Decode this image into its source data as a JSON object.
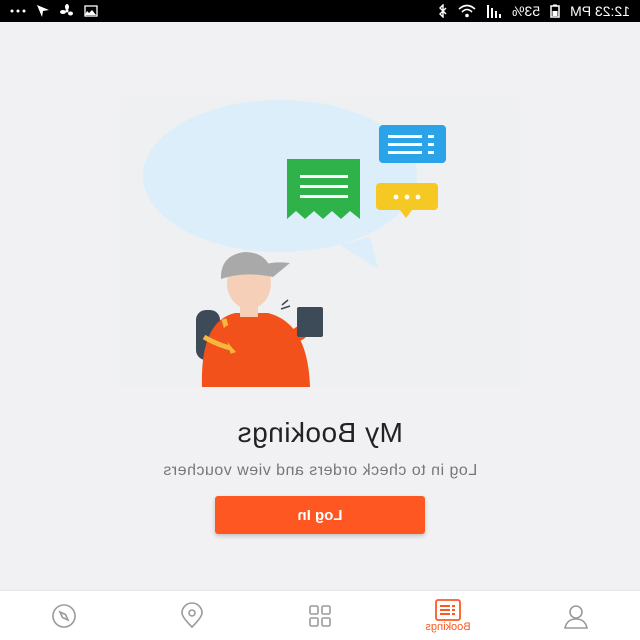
{
  "status_bar": {
    "time": "12:23 PM",
    "battery": "53%",
    "icons": [
      "bluetooth-icon",
      "wifi-icon",
      "signal-icon",
      "battery-icon",
      "more-icon",
      "location-arrow-icon",
      "fan-icon",
      "image-icon"
    ]
  },
  "main": {
    "title": "My Bookings",
    "subtitle": "Log in to check orders and view vouchers",
    "login_label": "Log In"
  },
  "bottom_nav": {
    "items": [
      {
        "icon": "compass-icon",
        "label": ""
      },
      {
        "icon": "location-pin-icon",
        "label": ""
      },
      {
        "icon": "grid-icon",
        "label": ""
      },
      {
        "icon": "bookings-icon",
        "label": "Bookings",
        "active": true
      },
      {
        "icon": "profile-icon",
        "label": ""
      }
    ]
  },
  "colors": {
    "accent": "#ff5722",
    "background": "#f1f1f3",
    "bubble": "#dff0fb",
    "green_card": "#2fb24a",
    "blue_card": "#2aa3e8",
    "yellow_card": "#f6c824"
  }
}
